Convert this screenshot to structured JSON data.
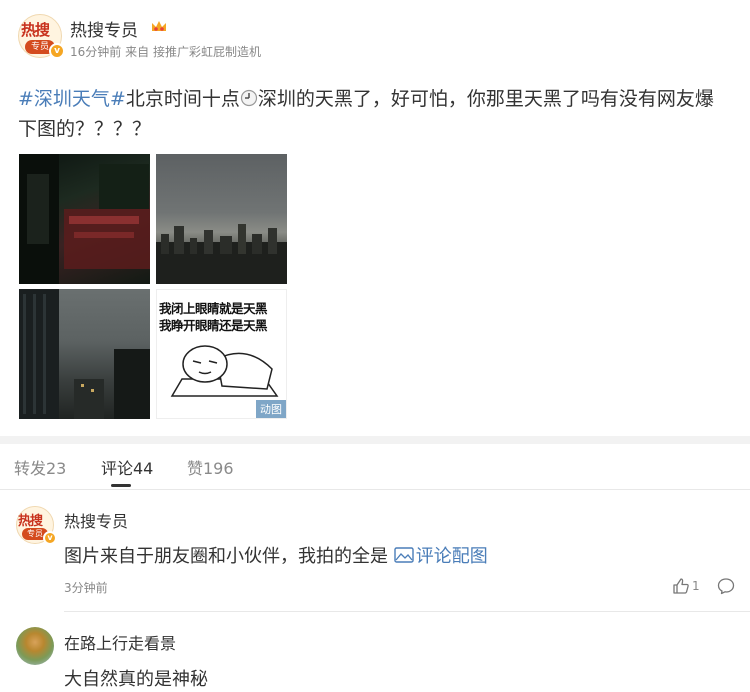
{
  "post": {
    "author": "热搜专员",
    "avatar_text": "热搜",
    "avatar_badge": "专员",
    "verified_icon": "v-badge",
    "member_icon": "crown-icon",
    "time": "16分钟前",
    "source_prefix": "来自",
    "source": "接推广彩虹屁制造机",
    "tag": "#深圳天气#",
    "text_before_icon": "北京时间十点",
    "text_after_icon": "深圳的天黑了，好可怕，你那里天黑了吗有没有网友爆下图的？？？？",
    "images": [
      {
        "name": "dark-street-banner-photo"
      },
      {
        "name": "dark-sky-skyline-photo"
      },
      {
        "name": "dark-building-photo"
      },
      {
        "name": "meme-gif",
        "line1": "我闭上眼睛就是天黑",
        "line2": "我睁开眼睛还是天黑",
        "badge": "动图"
      }
    ]
  },
  "tabs": [
    {
      "label": "转发23"
    },
    {
      "label": "评论44",
      "active": true
    },
    {
      "label": "赞196"
    }
  ],
  "comments": [
    {
      "author": "热搜专员",
      "avatar_text": "热搜",
      "avatar_badge": "专员",
      "text": "图片来自于朋友圈和小伙伴，我拍的全是 ",
      "link": "评论配图",
      "time": "3分钟前",
      "likes": "1"
    },
    {
      "author": "在路上行走看景",
      "text": "大自然真的是神秘"
    }
  ],
  "colors": {
    "link": "#4a7db8",
    "meta": "#888888",
    "text": "#333333"
  }
}
